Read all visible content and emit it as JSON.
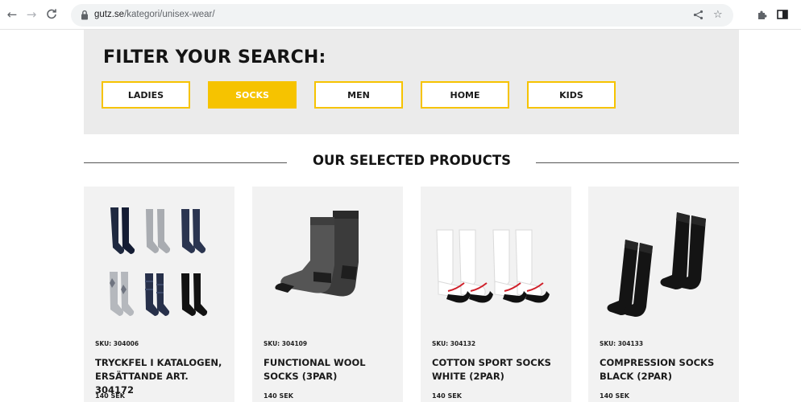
{
  "browser": {
    "url_host": "gutz.se",
    "url_path": "/kategori/unisex-wear/",
    "icons": [
      "back-arrow-icon",
      "forward-arrow-icon",
      "reload-icon",
      "lock-icon",
      "share-icon",
      "star-icon",
      "puzzle-icon",
      "sidepanel-icon"
    ]
  },
  "filter": {
    "title": "FILTER YOUR SEARCH:",
    "buttons": [
      {
        "label": "LADIES",
        "active": false
      },
      {
        "label": "SOCKS",
        "active": true
      },
      {
        "label": "MEN",
        "active": false
      },
      {
        "label": "HOME",
        "active": false
      },
      {
        "label": "KIDS",
        "active": false
      }
    ]
  },
  "products_section": {
    "title": "OUR SELECTED PRODUCTS"
  },
  "products": [
    {
      "sku": "SKU: 304006",
      "name": "TRYCKFEL I KATALOGEN, ERSÄTTANDE ART. 304172",
      "price": "140 SEK"
    },
    {
      "sku": "SKU: 304109",
      "name": "FUNCTIONAL WOOL SOCKS (3PAR)",
      "price": "140 SEK"
    },
    {
      "sku": "SKU: 304132",
      "name": "COTTON SPORT SOCKS WHITE (2PAR)",
      "price": "140 SEK"
    },
    {
      "sku": "SKU: 304133",
      "name": "COMPRESSION SOCKS BLACK (2PAR)",
      "price": "140 SEK"
    }
  ],
  "colors": {
    "accent": "#f6c300",
    "filter_bg": "#ebebeb",
    "card_bg": "#f2f2f2",
    "text": "#141414"
  }
}
